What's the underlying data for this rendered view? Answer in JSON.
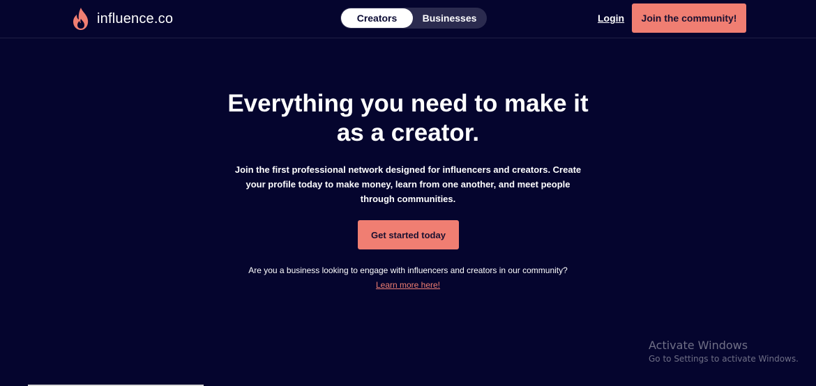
{
  "header": {
    "logo_text": "influence.co",
    "logo_icon": "flame-icon",
    "toggle": {
      "creators_label": "Creators",
      "businesses_label": "Businesses",
      "selected": "Creators"
    },
    "login_label": "Login",
    "join_label": "Join the community!"
  },
  "hero": {
    "title": "Everything you need to make it as a creator.",
    "subtitle": "Join the first professional network designed for influencers and creators. Create your profile today to make money, learn from one another, and meet people through communities.",
    "cta_label": "Get started today",
    "business_text": "Are you a business looking to engage with influencers and creators in our community?",
    "learn_more_label": "Learn more here!"
  },
  "watermark": {
    "title": "Activate Windows",
    "subtitle": "Go to Settings to activate Windows."
  },
  "colors": {
    "background": "#05052e",
    "accent": "#f07e72",
    "toggle_bg": "#2b2b4f",
    "white": "#ffffff"
  }
}
